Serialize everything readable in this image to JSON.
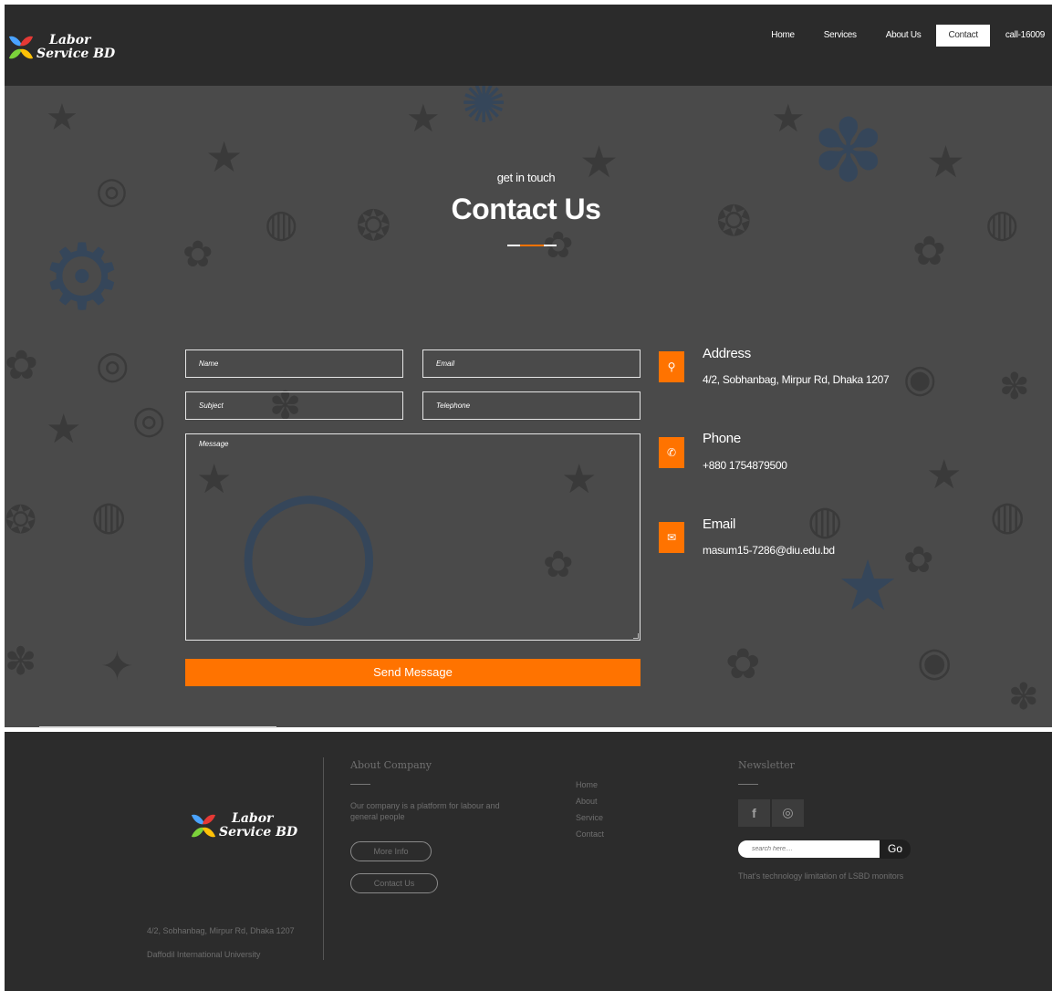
{
  "brand": {
    "line1": "Labor",
    "line2": "Service BD"
  },
  "nav": {
    "home": "Home",
    "services": "Services",
    "about": "About Us",
    "contact": "Contact",
    "call": "call-16009"
  },
  "hero": {
    "subtitle": "get in touch",
    "title": "Contact Us"
  },
  "form": {
    "name": "Name",
    "email": "Email",
    "subject": "Subject",
    "telephone": "Telephone",
    "message": "Message",
    "send": "Send Message"
  },
  "contact": {
    "address_label": "Address",
    "address": "4/2, Sobhanbag, Mirpur Rd, Dhaka 1207",
    "phone_label": "Phone",
    "phone": "+880 1754879500",
    "email_label": "Email",
    "email": "masum15-7286@diu.edu.bd"
  },
  "footer": {
    "address": "4/2, Sobhanbag, Mirpur Rd, Dhaka 1207",
    "university": "Daffodil International University",
    "about_heading": "About Company",
    "about_text": "Our company is a platform for labour and general people",
    "more_info": "More Info",
    "contact_us": "Contact Us",
    "links": [
      "Home",
      "About",
      "Service",
      "Contact"
    ],
    "newsletter_heading": "Newsletter",
    "search_placeholder": "search here....",
    "go": "Go",
    "note": "That's technology limitation of LSBD monitors"
  },
  "colors": {
    "accent": "#ff7300",
    "header_bg": "#2b2b2b",
    "hero_bg": "#4a4a4a",
    "footer_bg": "#2c2c2c"
  },
  "icons": {
    "address": "map-marker-icon",
    "phone": "phone-icon",
    "email": "envelope-icon",
    "facebook": "facebook-icon",
    "instagram": "instagram-icon"
  }
}
